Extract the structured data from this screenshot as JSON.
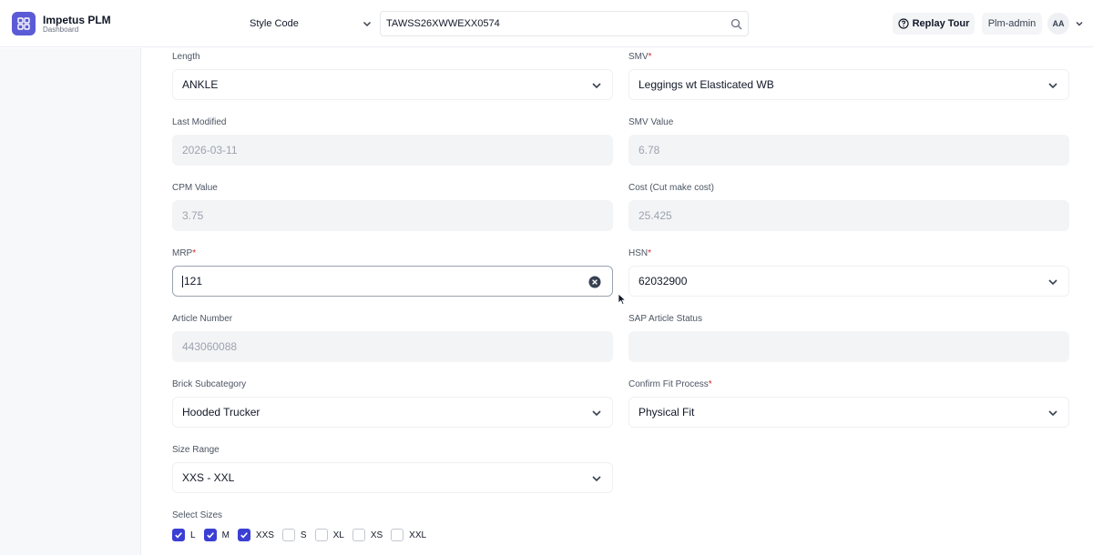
{
  "app": {
    "title": "Impetus PLM",
    "subtitle": "Dashboard",
    "brand_color": "#5b5bd6"
  },
  "search": {
    "type_label": "Style Code",
    "value": "TAWSS26XWWEXX0574"
  },
  "header": {
    "replay_tour_label": "Replay Tour",
    "user_label": "Plm-admin",
    "avatar_initials": "AA"
  },
  "form": {
    "length": {
      "label": "Length",
      "value": "ANKLE"
    },
    "smv": {
      "label": "SMV",
      "required": "*",
      "value": "Leggings wt Elasticated WB"
    },
    "last_modified": {
      "label": "Last Modified",
      "value": "2026-03-11"
    },
    "smv_value": {
      "label": "SMV Value",
      "value": "6.78"
    },
    "cpm_value": {
      "label": "CPM Value",
      "value": "3.75"
    },
    "cost": {
      "label": "Cost (Cut make cost)",
      "value": "25.425"
    },
    "mrp": {
      "label": "MRP",
      "required": "*",
      "value": "121"
    },
    "hsn": {
      "label": "HSN",
      "required": "*",
      "value": "62032900"
    },
    "article_number": {
      "label": "Article Number",
      "value": "443060088"
    },
    "sap_article_status": {
      "label": "SAP Article Status",
      "value": ""
    },
    "brick_subcategory": {
      "label": "Brick Subcategory",
      "value": "Hooded Trucker"
    },
    "confirm_fit_process": {
      "label": "Confirm Fit Process",
      "required": "*",
      "value": "Physical Fit"
    },
    "size_range": {
      "label": "Size Range",
      "value": "XXS - XXL"
    },
    "select_sizes": {
      "label": "Select Sizes",
      "options": [
        {
          "label": "L",
          "checked": true
        },
        {
          "label": "M",
          "checked": true
        },
        {
          "label": "XXS",
          "checked": true
        },
        {
          "label": "S",
          "checked": false
        },
        {
          "label": "XL",
          "checked": false
        },
        {
          "label": "XS",
          "checked": false
        },
        {
          "label": "XXL",
          "checked": false
        }
      ]
    }
  },
  "colors": {
    "accent": "#3b3fd4",
    "required": "#dc2626",
    "disabled_bg": "#f3f4f6"
  }
}
